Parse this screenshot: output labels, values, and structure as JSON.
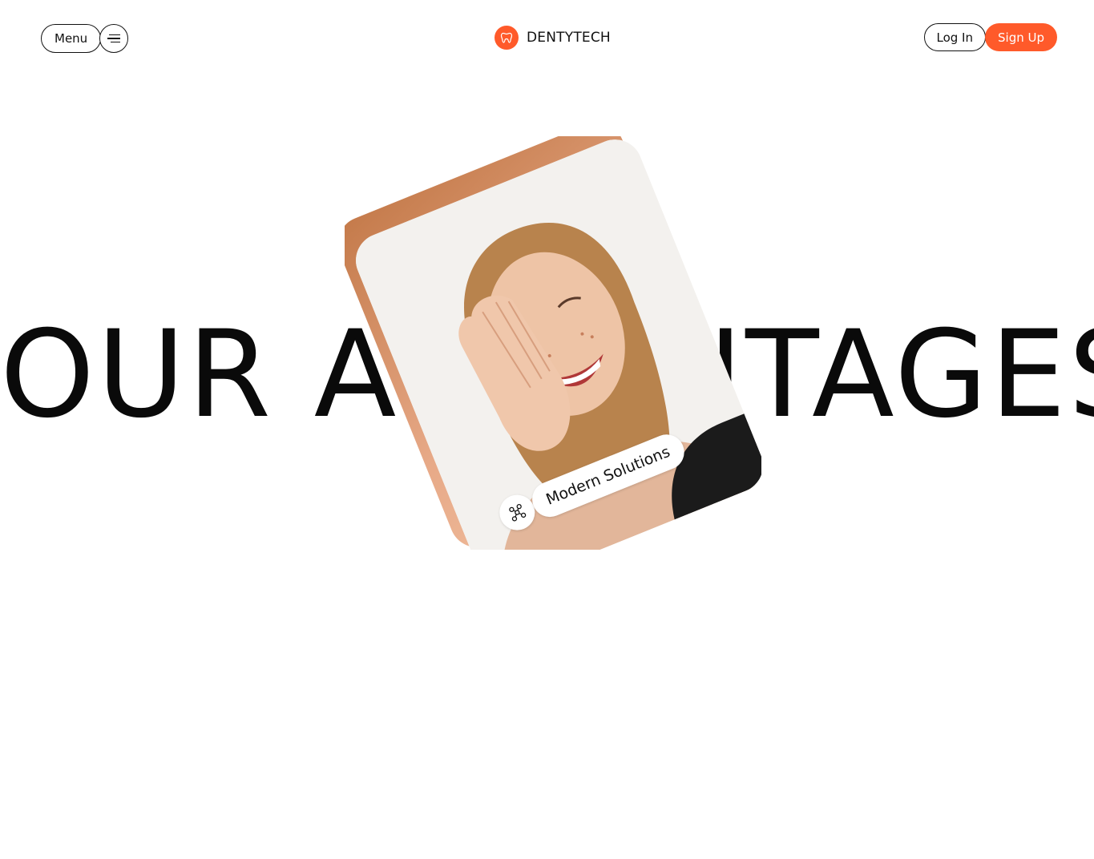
{
  "header": {
    "menu_label": "Menu",
    "menu_icon": "hamburger-icon",
    "brand_name": "DENTYTECH",
    "brand_icon": "tooth-icon",
    "login_label": "Log In",
    "signup_label": "Sign Up"
  },
  "hero": {
    "title": "OUR ADVANTAGES",
    "card_tag": "Modern Solutions",
    "card_tag_icon": "network-nodes-icon"
  },
  "colors": {
    "accent": "#ff5a2a",
    "text": "#0a0a0a",
    "background": "#ffffff"
  }
}
